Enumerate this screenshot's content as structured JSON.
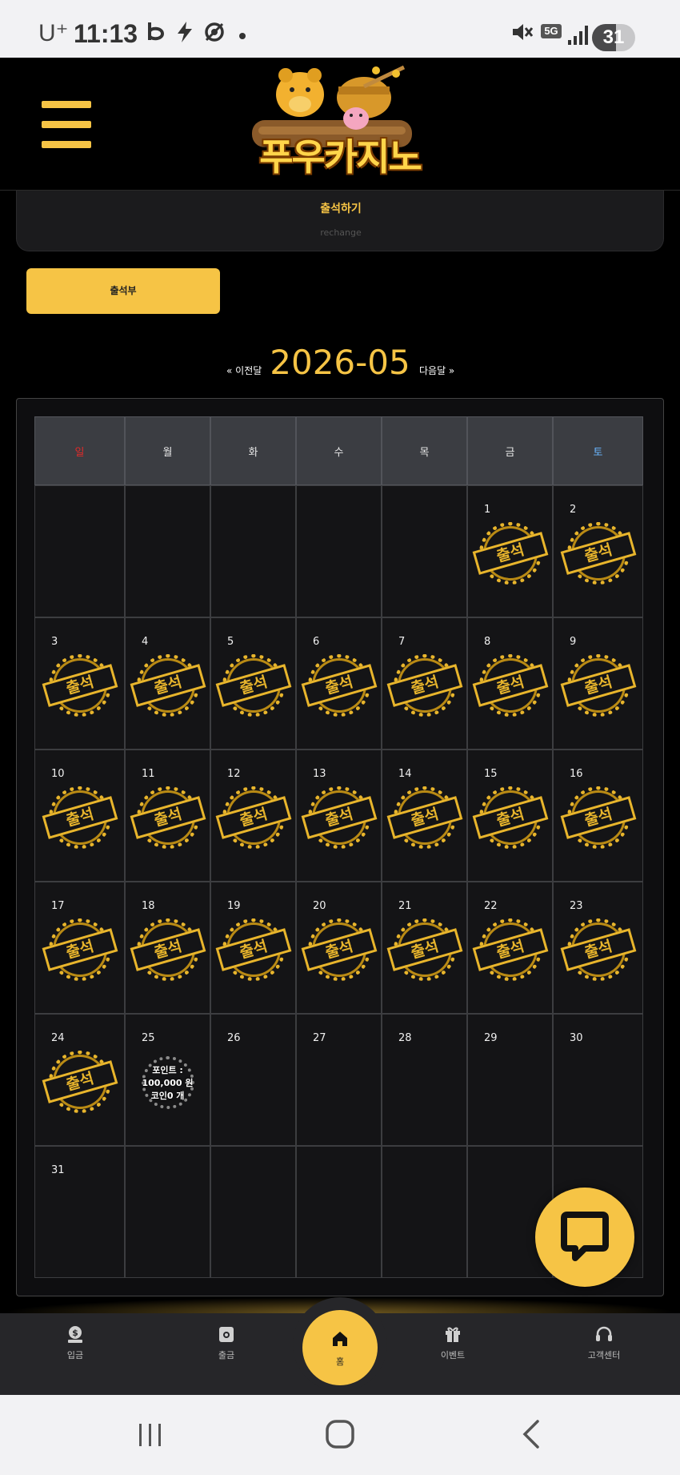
{
  "status_bar": {
    "carrier": "U⁺",
    "time": "11:13",
    "network": "5G",
    "battery": "31"
  },
  "header": {
    "logo_text": "푸우카지노"
  },
  "attendance_card": {
    "title": "출석하기",
    "subtitle": "rechange"
  },
  "attendance_button": "출석부",
  "month_nav": {
    "prev": "« 이전달",
    "title": "2026-05",
    "next": "다음달 »"
  },
  "calendar": {
    "weekdays": [
      "일",
      "월",
      "화",
      "수",
      "목",
      "금",
      "토"
    ],
    "stamp_label": "출석",
    "point_stamp": {
      "line1": "포인트 :",
      "line2": "100,000 원",
      "line3": "코인0 개"
    },
    "days": [
      {
        "n": ""
      },
      {
        "n": ""
      },
      {
        "n": ""
      },
      {
        "n": ""
      },
      {
        "n": ""
      },
      {
        "n": "1",
        "s": "att"
      },
      {
        "n": "2",
        "s": "att"
      },
      {
        "n": "3",
        "s": "att"
      },
      {
        "n": "4",
        "s": "att"
      },
      {
        "n": "5",
        "s": "att"
      },
      {
        "n": "6",
        "s": "att"
      },
      {
        "n": "7",
        "s": "att"
      },
      {
        "n": "8",
        "s": "att"
      },
      {
        "n": "9",
        "s": "att"
      },
      {
        "n": "10",
        "s": "att"
      },
      {
        "n": "11",
        "s": "att"
      },
      {
        "n": "12",
        "s": "att"
      },
      {
        "n": "13",
        "s": "att"
      },
      {
        "n": "14",
        "s": "att"
      },
      {
        "n": "15",
        "s": "att"
      },
      {
        "n": "16",
        "s": "att"
      },
      {
        "n": "17",
        "s": "att"
      },
      {
        "n": "18",
        "s": "att"
      },
      {
        "n": "19",
        "s": "att"
      },
      {
        "n": "20",
        "s": "att"
      },
      {
        "n": "21",
        "s": "att"
      },
      {
        "n": "22",
        "s": "att"
      },
      {
        "n": "23",
        "s": "att"
      },
      {
        "n": "24",
        "s": "att"
      },
      {
        "n": "25",
        "s": "point"
      },
      {
        "n": "26"
      },
      {
        "n": "27"
      },
      {
        "n": "28"
      },
      {
        "n": "29"
      },
      {
        "n": "30"
      },
      {
        "n": "31"
      },
      {
        "n": ""
      },
      {
        "n": ""
      },
      {
        "n": ""
      },
      {
        "n": ""
      },
      {
        "n": ""
      },
      {
        "n": ""
      }
    ]
  },
  "bottom_nav": {
    "deposit": "입금",
    "withdraw": "출금",
    "home": "홈",
    "event": "이벤트",
    "support": "고객센터"
  },
  "colors": {
    "accent": "#f6c445",
    "sunday": "#e02a2a",
    "saturday": "#6ab6ff",
    "background": "#000000"
  },
  "icons": [
    "hamburger-menu-icon",
    "chat-bubble-icon",
    "dollar-coin-icon",
    "wallet-icon",
    "home-icon",
    "gift-icon",
    "headset-icon"
  ]
}
